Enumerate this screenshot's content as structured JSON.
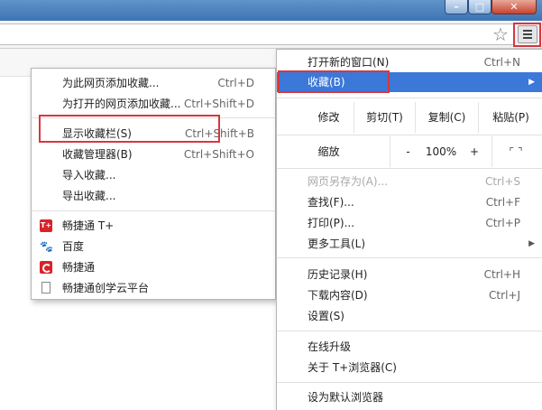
{
  "toolbar": {
    "star_icon": "star-icon",
    "menu_icon": "hamburger-menu-icon"
  },
  "bookmarks_menu": {
    "items": [
      {
        "label": "为此网页添加收藏...",
        "shortcut": "Ctrl+D"
      },
      {
        "label": "为打开的网页添加收藏...",
        "shortcut": "Ctrl+Shift+D"
      },
      {
        "label": "显示收藏栏(S)",
        "shortcut": "Ctrl+Shift+B"
      },
      {
        "label": "收藏管理器(B)",
        "shortcut": "Ctrl+Shift+O"
      },
      {
        "label": "导入收藏..."
      },
      {
        "label": "导出收藏..."
      }
    ],
    "bookmarks": [
      {
        "label": "畅捷通 T+",
        "icon": "tplus-favicon",
        "icon_text": "T+"
      },
      {
        "label": "百度",
        "icon": "baidu-paw-favicon"
      },
      {
        "label": "畅捷通",
        "icon": "chanjet-favicon"
      },
      {
        "label": "畅捷通创学云平台",
        "icon": "page-icon"
      }
    ]
  },
  "main_menu": {
    "new_window": {
      "label": "打开新的窗口(N)",
      "shortcut": "Ctrl+N"
    },
    "bookmarks": {
      "label": "收藏(B)"
    },
    "edit": {
      "label": "修改",
      "cut": "剪切(T)",
      "copy": "复制(C)",
      "paste": "粘贴(P)"
    },
    "zoom": {
      "label": "缩放",
      "minus": "-",
      "value": "100%",
      "plus": "+"
    },
    "items_a": [
      {
        "label": "网页另存为(A)...",
        "shortcut": "Ctrl+S",
        "disabled": true
      },
      {
        "label": "查找(F)...",
        "shortcut": "Ctrl+F"
      },
      {
        "label": "打印(P)...",
        "shortcut": "Ctrl+P"
      },
      {
        "label": "更多工具(L)"
      }
    ],
    "items_b": [
      {
        "label": "历史记录(H)",
        "shortcut": "Ctrl+H"
      },
      {
        "label": "下载内容(D)",
        "shortcut": "Ctrl+J"
      },
      {
        "label": "设置(S)"
      }
    ],
    "items_c": [
      {
        "label": "在线升级"
      },
      {
        "label": "关于 T+浏览器(C)"
      }
    ],
    "default_browser": {
      "label": "设为默认浏览器"
    }
  },
  "colors": {
    "selected": "#3b78d8",
    "highlight_box": "#d9363e"
  }
}
